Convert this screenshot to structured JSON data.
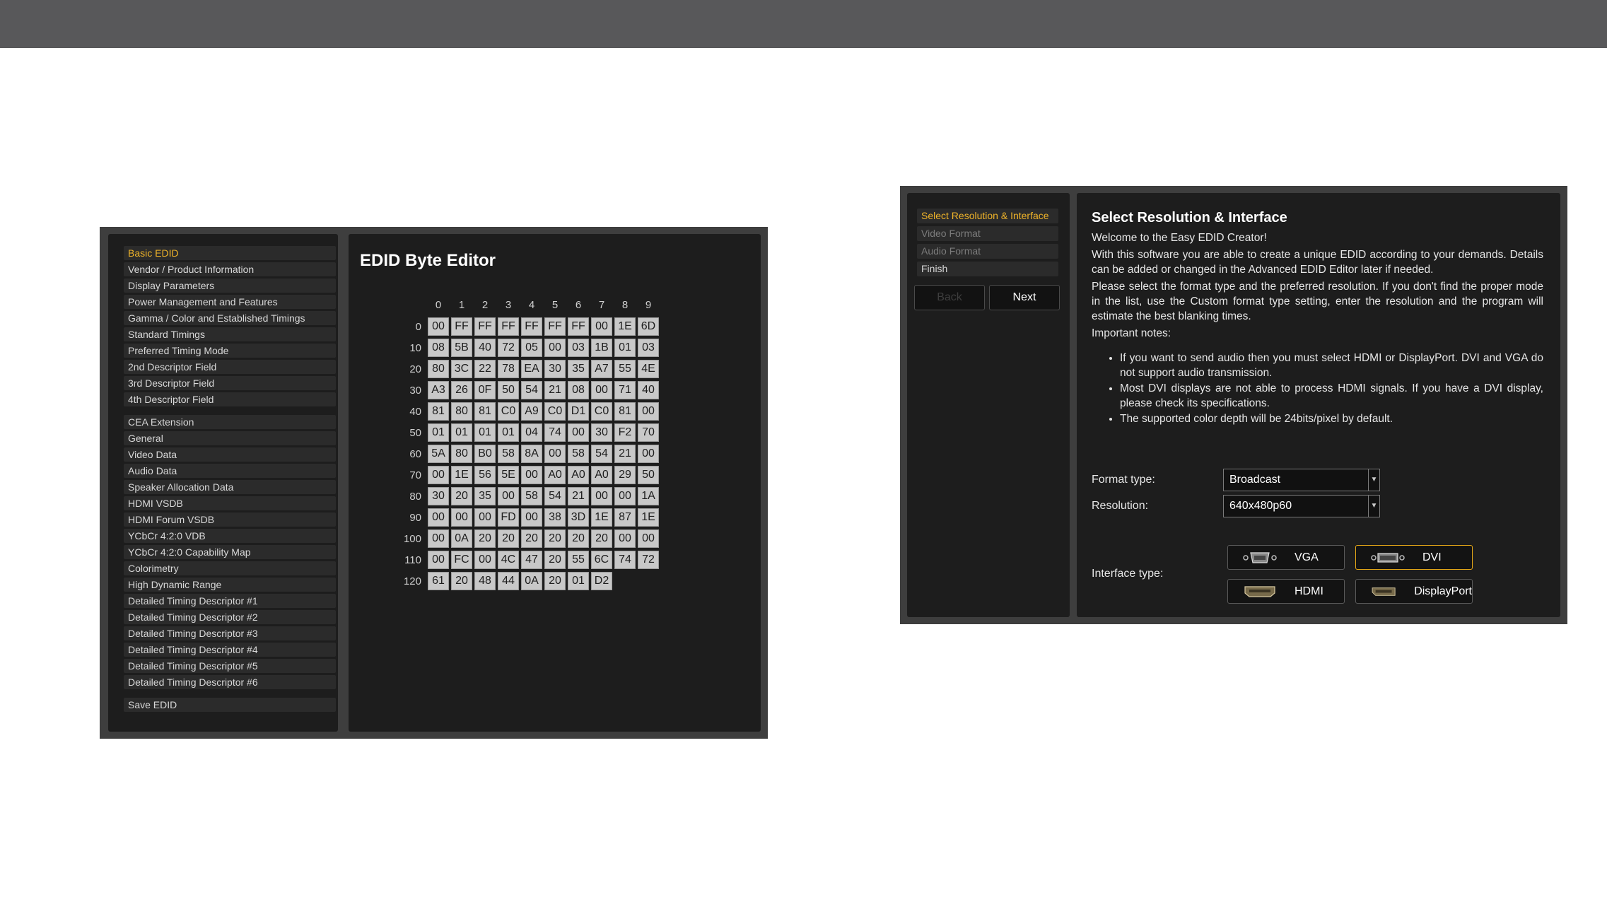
{
  "basic_nav": {
    "group1": [
      "Basic EDID",
      "Vendor / Product Information",
      "Display Parameters",
      "Power Management and Features",
      "Gamma / Color and Established Timings",
      "Standard Timings",
      "Preferred Timing Mode",
      "2nd Descriptor Field",
      "3rd Descriptor Field",
      "4th Descriptor Field"
    ],
    "group2": [
      "CEA Extension",
      "General",
      "Video Data",
      "Audio Data",
      "Speaker Allocation Data",
      "HDMI VSDB",
      "HDMI Forum VSDB",
      "YCbCr 4:2:0 VDB",
      "YCbCr 4:2:0 Capability Map",
      "Colorimetry",
      "High Dynamic Range",
      "Detailed Timing Descriptor #1",
      "Detailed Timing Descriptor #2",
      "Detailed Timing Descriptor #3",
      "Detailed Timing Descriptor #4",
      "Detailed Timing Descriptor #5",
      "Detailed Timing Descriptor #6"
    ],
    "group3": [
      "Save EDID"
    ],
    "active": "Basic EDID"
  },
  "byte_editor": {
    "title": "EDID Byte Editor",
    "columns": [
      "0",
      "1",
      "2",
      "3",
      "4",
      "5",
      "6",
      "7",
      "8",
      "9"
    ],
    "rows": [
      {
        "label": "0",
        "bytes": [
          "00",
          "FF",
          "FF",
          "FF",
          "FF",
          "FF",
          "FF",
          "00",
          "1E",
          "6D"
        ]
      },
      {
        "label": "10",
        "bytes": [
          "08",
          "5B",
          "40",
          "72",
          "05",
          "00",
          "03",
          "1B",
          "01",
          "03"
        ]
      },
      {
        "label": "20",
        "bytes": [
          "80",
          "3C",
          "22",
          "78",
          "EA",
          "30",
          "35",
          "A7",
          "55",
          "4E"
        ]
      },
      {
        "label": "30",
        "bytes": [
          "A3",
          "26",
          "0F",
          "50",
          "54",
          "21",
          "08",
          "00",
          "71",
          "40"
        ]
      },
      {
        "label": "40",
        "bytes": [
          "81",
          "80",
          "81",
          "C0",
          "A9",
          "C0",
          "D1",
          "C0",
          "81",
          "00"
        ]
      },
      {
        "label": "50",
        "bytes": [
          "01",
          "01",
          "01",
          "01",
          "04",
          "74",
          "00",
          "30",
          "F2",
          "70"
        ]
      },
      {
        "label": "60",
        "bytes": [
          "5A",
          "80",
          "B0",
          "58",
          "8A",
          "00",
          "58",
          "54",
          "21",
          "00"
        ]
      },
      {
        "label": "70",
        "bytes": [
          "00",
          "1E",
          "56",
          "5E",
          "00",
          "A0",
          "A0",
          "A0",
          "29",
          "50"
        ]
      },
      {
        "label": "80",
        "bytes": [
          "30",
          "20",
          "35",
          "00",
          "58",
          "54",
          "21",
          "00",
          "00",
          "1A"
        ]
      },
      {
        "label": "90",
        "bytes": [
          "00",
          "00",
          "00",
          "FD",
          "00",
          "38",
          "3D",
          "1E",
          "87",
          "1E"
        ]
      },
      {
        "label": "100",
        "bytes": [
          "00",
          "0A",
          "20",
          "20",
          "20",
          "20",
          "20",
          "20",
          "00",
          "00"
        ]
      },
      {
        "label": "110",
        "bytes": [
          "00",
          "FC",
          "00",
          "4C",
          "47",
          "20",
          "55",
          "6C",
          "74",
          "72"
        ]
      },
      {
        "label": "120",
        "bytes": [
          "61",
          "20",
          "48",
          "44",
          "0A",
          "20",
          "01",
          "D2"
        ]
      }
    ]
  },
  "wizard": {
    "steps": [
      "Select Resolution & Interface",
      "Video Format",
      "Audio Format",
      "Finish"
    ],
    "back_label": "Back",
    "next_label": "Next",
    "title": "Select Resolution & Interface",
    "welcome": "Welcome to the Easy EDID Creator!",
    "para1": "With this software you are able to create a unique EDID according to your demands. Details can be added or changed in the Advanced EDID Editor later if needed.",
    "para2": "Please select the format type and the preferred resolution. If you don't find the proper mode in the list, use the Custom format type setting, enter the resolution and the program will estimate the best blanking times.",
    "notes_heading": "Important notes:",
    "notes": [
      "If you want to send audio then you must select HDMI or DisplayPort. DVI and VGA do not support audio transmission.",
      "Most DVI displays are not able to process HDMI signals. If you have a DVI display, please check its specifications.",
      "The supported color depth will be 24bits/pixel by default."
    ],
    "format_label": "Format type:",
    "format_value": "Broadcast",
    "resolution_label": "Resolution:",
    "resolution_value": "640x480p60",
    "interface_label": "Interface type:",
    "interfaces": {
      "vga": "VGA",
      "dvi": "DVI",
      "hdmi": "HDMI",
      "displayport": "DisplayPort"
    },
    "selected_interface": "DVI"
  },
  "colors": {
    "accent": "#f0b429",
    "panel": "#1d1d1d",
    "frame": "#3e3e3e",
    "selected_border": "#e6a817"
  }
}
